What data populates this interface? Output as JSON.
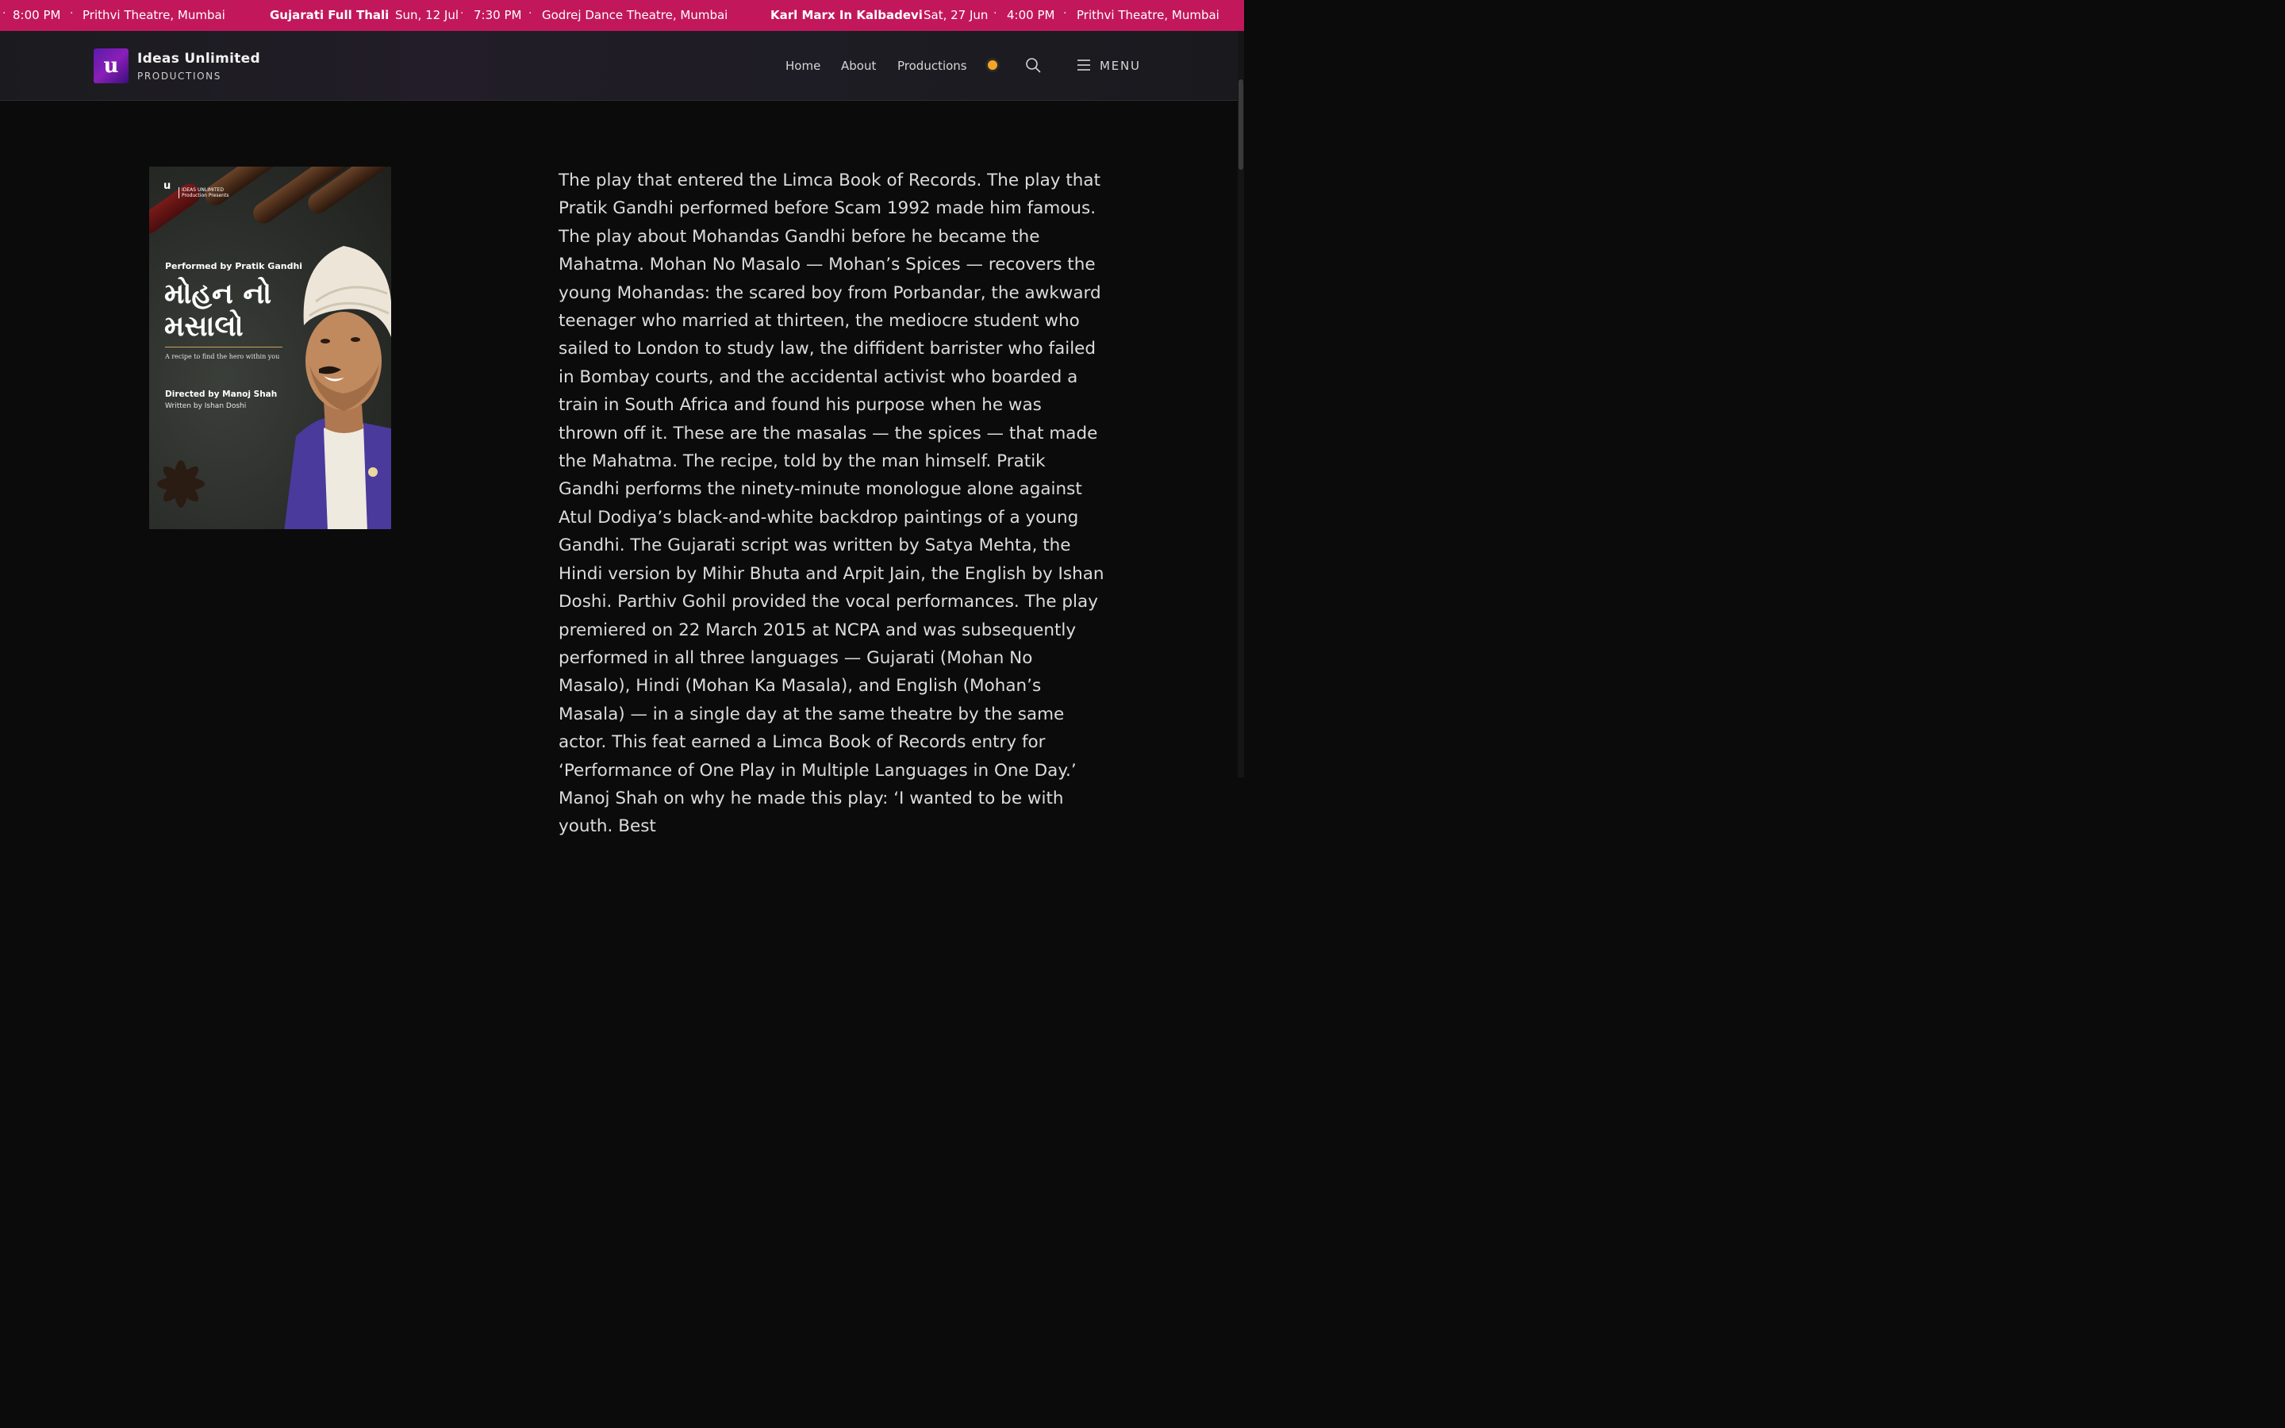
{
  "ticker": {
    "items": [
      {
        "time": "8:00 PM",
        "venue": "Prithvi Theatre, Mumbai"
      },
      {
        "title": "Gujarati Full Thali",
        "date": "Sun, 12 Jul",
        "time": "7:30 PM",
        "venue": "Godrej Dance Theatre, Mumbai"
      },
      {
        "title": "Karl Marx In Kalbadevi",
        "date": "Sat, 27 Jun",
        "time": "4:00 PM",
        "venue": "Prithvi Theatre, Mumbai"
      }
    ]
  },
  "header": {
    "logo_letter": "u",
    "brand_name": "Ideas Unlimited",
    "brand_sub": "PRODUCTIONS",
    "nav": [
      "Home",
      "About",
      "Productions"
    ],
    "menu_label": "MENU",
    "theme_dot_color": "#f5a623",
    "icons": [
      "theme-toggle",
      "search-icon",
      "hamburger-menu-icon"
    ]
  },
  "poster": {
    "brand_line1": "IDEAS UNLIMITED",
    "brand_line2": "Production Presents",
    "performed_by": "Performed by Pratik Gandhi",
    "title_line1": "મોહન નો",
    "title_line2": "મસાલો",
    "tagline": "A recipe to find the hero within you",
    "directed_by": "Directed by Manoj Shah",
    "written_by": "Written by Ishan Doshi"
  },
  "article": {
    "body": "The play that entered the Limca Book of Records. The play that Pratik Gandhi performed before Scam 1992 made him famous. The play about Mohandas Gandhi before he became the Mahatma. Mohan No Masalo — Mohan’s Spices — recovers the young Mohandas: the scared boy from Porbandar, the awkward teenager who married at thirteen, the mediocre student who sailed to London to study law, the diffident barrister who failed in Bombay courts, and the accidental activist who boarded a train in South Africa and found his purpose when he was thrown off it. These are the masalas — the spices — that made the Mahatma. The recipe, told by the man himself. Pratik Gandhi performs the ninety-minute monologue alone against Atul Dodiya’s black-and-white backdrop paintings of a young Gandhi. The Gujarati script was written by Satya Mehta, the Hindi version by Mihir Bhuta and Arpit Jain, the English by Ishan Doshi. Parthiv Gohil provided the vocal performances. The play premiered on 22 March 2015 at NCPA and was subsequently performed in all three languages — Gujarati (Mohan No Masalo), Hindi (Mohan Ka Masala), and English (Mohan’s Masala) — in a single day at the same theatre by the same actor. This feat earned a Limca Book of Records entry for ‘Performance of One Play in Multiple Languages in One Day.’ Manoj Shah on why he made this play: ‘I wanted to be with youth. Best"
  },
  "colors": {
    "ticker_bg": "#c2185b",
    "page_bg": "#0b0b0b",
    "accent_dot": "#f5a623"
  }
}
